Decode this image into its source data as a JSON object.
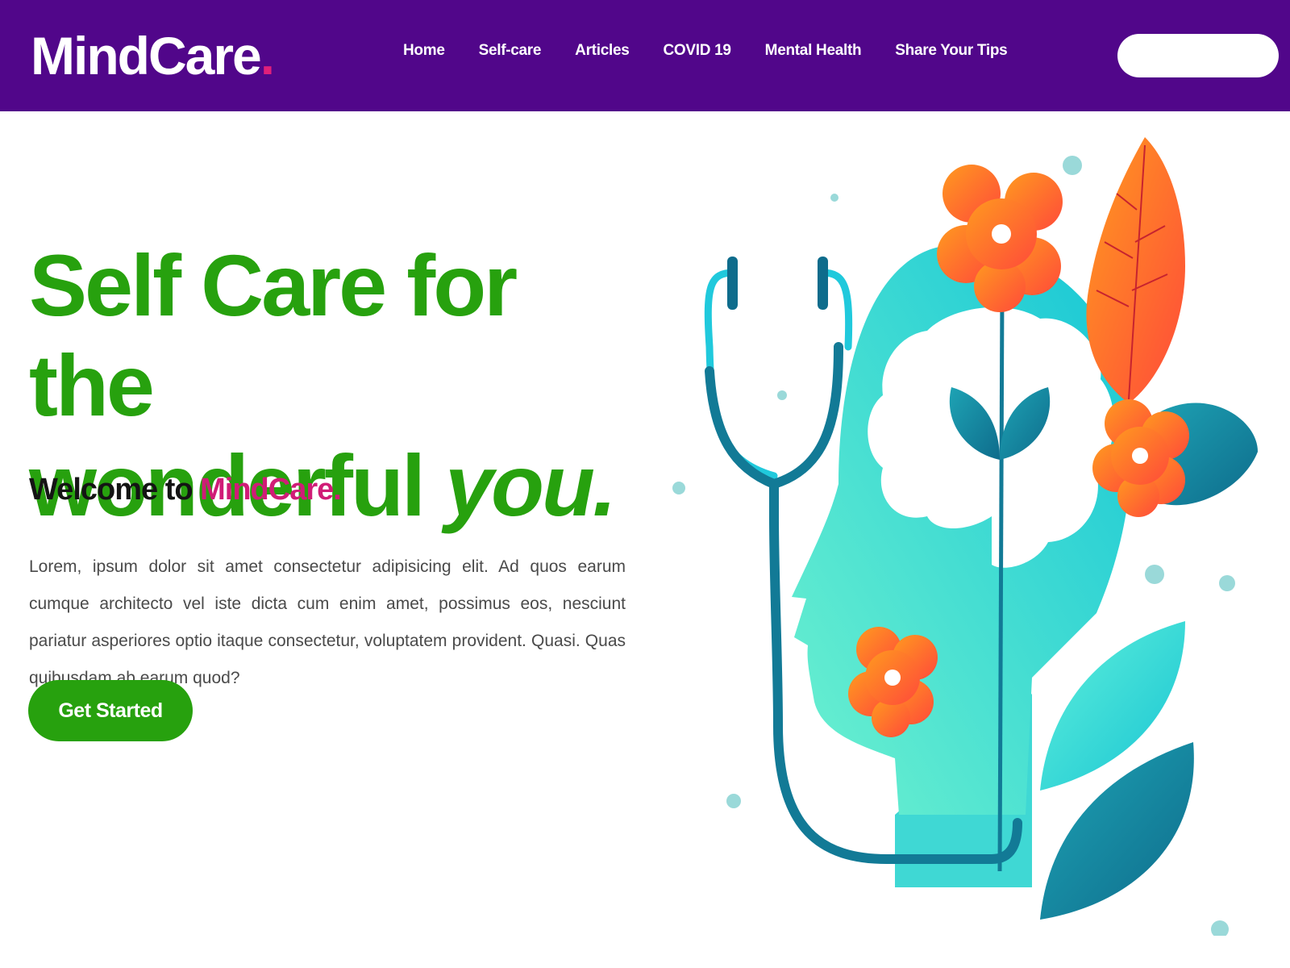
{
  "brand": {
    "name": "MindCare",
    "dot": ".",
    "accent": "#e0207a"
  },
  "nav": {
    "items": [
      {
        "label": "Home"
      },
      {
        "label": "Self-care"
      },
      {
        "label": "Articles"
      },
      {
        "label": "COVID 19"
      },
      {
        "label": "Mental Health"
      },
      {
        "label": "Share Your Tips"
      }
    ],
    "search_value": ""
  },
  "hero": {
    "title_line1": "Self Care for the",
    "title_line2": "wonderful ",
    "title_emphasis": "you.",
    "welcome_prefix": "Welcome to ",
    "welcome_brand": "MindCare.",
    "paragraph": "Lorem, ipsum dolor sit amet consectetur adipisicing elit. Ad quos earum cumque architecto vel iste dicta cum enim amet, possimus eos, nesciunt pariatur asperiores optio itaque consectetur, voluptatem provident. Quasi. Quas quibusdam ab earum quod?",
    "cta_label": "Get Started"
  },
  "colors": {
    "nav_bg": "#51068a",
    "primary_green": "#27a10e",
    "brand_pink": "#d01c77",
    "text_dark": "#141414",
    "text_body": "#4a4a4a",
    "illustration_teal": "#33d6d6",
    "illustration_dark_teal": "#127a96",
    "illustration_orange": "#ff6a2a"
  },
  "illustration": {
    "icon": "mental-health-head-stethoscope-illustration"
  }
}
